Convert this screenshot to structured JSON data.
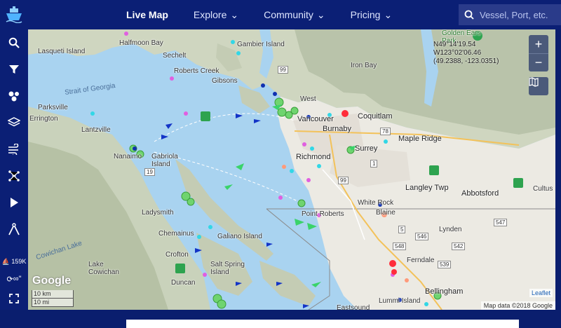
{
  "nav": {
    "items": [
      {
        "label": "Live Map",
        "active": true,
        "dropdown": false
      },
      {
        "label": "Explore",
        "active": false,
        "dropdown": true
      },
      {
        "label": "Community",
        "active": false,
        "dropdown": true
      },
      {
        "label": "Pricing",
        "active": false,
        "dropdown": true
      }
    ]
  },
  "search": {
    "placeholder": "Vessel, Port, etc."
  },
  "sidebar": {
    "tools": [
      "search-icon",
      "filter-icon",
      "density-icon",
      "layers-icon",
      "weather-icon",
      "route-icon",
      "play-icon",
      "measure-icon"
    ],
    "vessel_count": "159K",
    "sync_label": "∞\""
  },
  "map": {
    "coords": {
      "lat": "N49°14'19.54",
      "lon": "W123°02'06.46",
      "decimal": "(49.2388, -123.0351)"
    },
    "zoom_in": "+",
    "zoom_out": "−",
    "attribution": "Map data ©2018 Google",
    "leaflet": "Leaflet",
    "google": "Google",
    "scale_km": "10 km",
    "scale_m": "10 mi",
    "labels": {
      "lasqueti": "Lasqueti Island",
      "halfmoon": "Halfmoon Bay",
      "sechelt": "Sechelt",
      "gambier": "Gambier Island",
      "roberts_creek": "Roberts Creek",
      "gibsons": "Gibsons",
      "strait": "Strait of Georgia",
      "parksville": "Parksville",
      "errington": "Errington",
      "lantzville": "Lantzville",
      "nanaimo": "Nanaimo",
      "gabriola": "Gabriola Island",
      "west": "West",
      "vancouver": "Vancouver",
      "burnaby": "Burnaby",
      "coquitlam": "Coquitlam",
      "maple_ridge": "Maple Ridge",
      "surrey": "Surrey",
      "richmond": "Richmond",
      "langley": "Langley Twp",
      "abbotsford": "Abbotsford",
      "cultus": "Cultus",
      "ladysmith": "Ladysmith",
      "white_rock": "White Rock",
      "blaine": "Blaine",
      "point_roberts": "Point Roberts",
      "lynden": "Lynden",
      "chemainus": "Chemainus",
      "galiano": "Galiano Island",
      "cowichan_lake": "Cowichan Lake",
      "lake_cowichan": "Lake\nCowichan",
      "crofton": "Crofton",
      "saltspring": "Salt Spring\nIsland",
      "duncan": "Duncan",
      "ferndale": "Ferndale",
      "bellingham": "Bellingham",
      "lummi": "Lummi Island",
      "eastsound": "Eastsound",
      "iron_bay": "Iron Bay",
      "golden_ears": "Golden Ears\nPark",
      "hwy_99a": "99",
      "hwy_99b": "99",
      "hwy_78": "78",
      "hwy_1": "1",
      "hwy_19": "19",
      "hwy_5": "5",
      "hwy_546": "546",
      "hwy_548": "548",
      "hwy_547": "547",
      "hwy_539": "539",
      "hwy_542": "542"
    }
  }
}
